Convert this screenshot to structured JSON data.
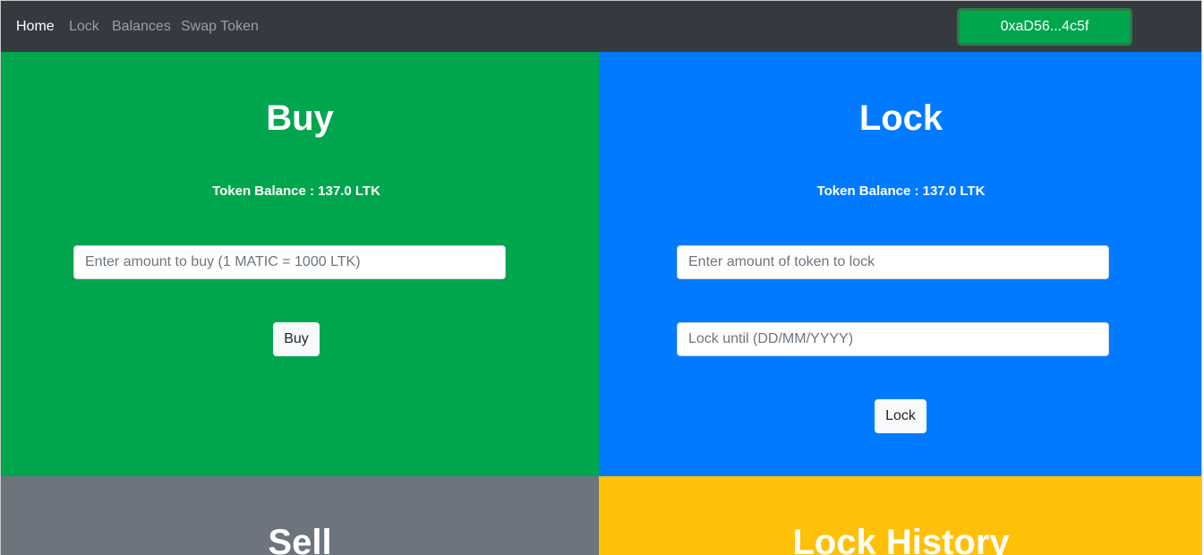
{
  "nav": {
    "links": [
      "Home",
      "Lock",
      "Balances",
      "Swap Token"
    ],
    "wallet_label": "0xaD56...4c5f"
  },
  "buy": {
    "title": "Buy",
    "balance": "Token Balance : 137.0 LTK",
    "amount_placeholder": "Enter amount to buy (1 MATIC = 1000 LTK)",
    "button": "Buy"
  },
  "lock": {
    "title": "Lock",
    "balance": "Token Balance : 137.0 LTK",
    "amount_placeholder": "Enter amount of token to lock",
    "date_placeholder": "Lock until (DD/MM/YYYY)",
    "button": "Lock"
  },
  "sell": {
    "title": "Sell"
  },
  "history": {
    "title": "Lock History"
  },
  "colors": {
    "navbar": "#343a40",
    "buy_panel": "#00a64d",
    "lock_panel": "#007bff",
    "sell_panel": "#6c757d",
    "history_panel": "#ffc107",
    "wallet_button": "#00a64d"
  }
}
